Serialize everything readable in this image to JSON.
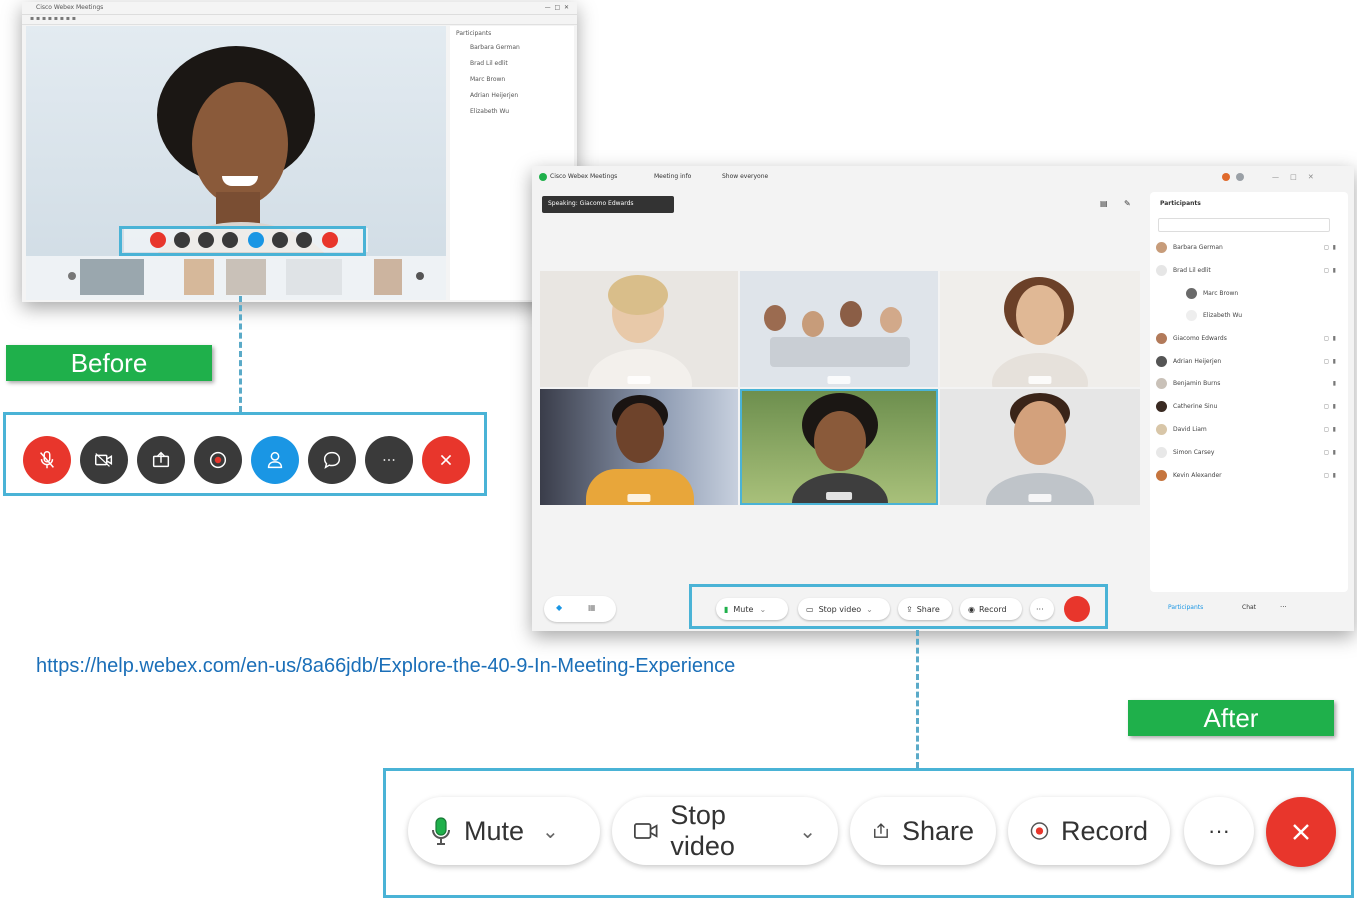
{
  "labels": {
    "before": "Before",
    "after": "After"
  },
  "link": "https://help.webex.com/en-us/8a66jdb/Explore-the-40-9-In-Meeting-Experience",
  "after_toolbar": {
    "mute": "Mute",
    "stop_video": "Stop video",
    "share": "Share",
    "record": "Record",
    "more": "···"
  },
  "new_window": {
    "title": "Cisco Webex Meetings",
    "meeting_info": "Meeting info",
    "layout": "Show everyone",
    "speaking": "Speaking: Giacomo Edwards",
    "panel_title": "Participants",
    "participants": [
      "Barbara German",
      "Brad Lil edlit",
      "Marc Brown",
      "Elizabeth Wu",
      "Giacomo Edwards",
      "Adrian Heijerjen",
      "Benjamin Burns",
      "Catherine Sinu",
      "David Liam",
      "Simon Carsey",
      "Kevin Alexander"
    ],
    "tab_participants": "Participants",
    "tab_chat": "Chat",
    "mini_toolbar": {
      "mute": "Mute",
      "stop_video": "Stop video",
      "share": "Share",
      "record": "Record"
    }
  },
  "old_window": {
    "title": "Cisco Webex Meetings",
    "panel_title": "Participants",
    "participants": [
      "Barbara German",
      "Brad Lil edlit",
      "Marc Brown",
      "Adrian Heijerjen",
      "Elizabeth Wu"
    ]
  },
  "colors": {
    "accent": "#4ab3d6",
    "green": "#1fb04b",
    "red": "#e8362c",
    "dark": "#3a3a3a",
    "blue": "#1a96e4"
  }
}
